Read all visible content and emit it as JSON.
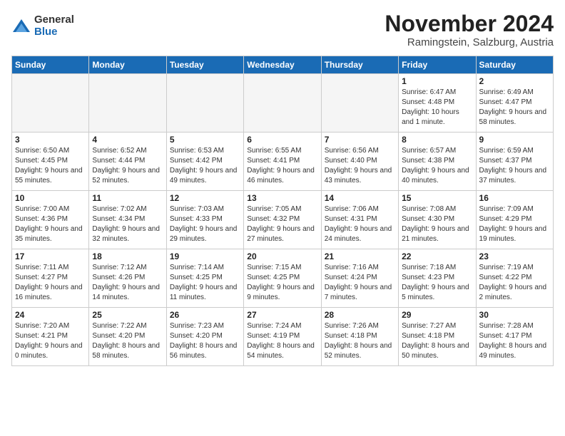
{
  "logo": {
    "general": "General",
    "blue": "Blue"
  },
  "header": {
    "month": "November 2024",
    "location": "Ramingstein, Salzburg, Austria"
  },
  "weekdays": [
    "Sunday",
    "Monday",
    "Tuesday",
    "Wednesday",
    "Thursday",
    "Friday",
    "Saturday"
  ],
  "weeks": [
    [
      {
        "day": "",
        "info": ""
      },
      {
        "day": "",
        "info": ""
      },
      {
        "day": "",
        "info": ""
      },
      {
        "day": "",
        "info": ""
      },
      {
        "day": "",
        "info": ""
      },
      {
        "day": "1",
        "info": "Sunrise: 6:47 AM\nSunset: 4:48 PM\nDaylight: 10 hours and 1 minute."
      },
      {
        "day": "2",
        "info": "Sunrise: 6:49 AM\nSunset: 4:47 PM\nDaylight: 9 hours and 58 minutes."
      }
    ],
    [
      {
        "day": "3",
        "info": "Sunrise: 6:50 AM\nSunset: 4:45 PM\nDaylight: 9 hours and 55 minutes."
      },
      {
        "day": "4",
        "info": "Sunrise: 6:52 AM\nSunset: 4:44 PM\nDaylight: 9 hours and 52 minutes."
      },
      {
        "day": "5",
        "info": "Sunrise: 6:53 AM\nSunset: 4:42 PM\nDaylight: 9 hours and 49 minutes."
      },
      {
        "day": "6",
        "info": "Sunrise: 6:55 AM\nSunset: 4:41 PM\nDaylight: 9 hours and 46 minutes."
      },
      {
        "day": "7",
        "info": "Sunrise: 6:56 AM\nSunset: 4:40 PM\nDaylight: 9 hours and 43 minutes."
      },
      {
        "day": "8",
        "info": "Sunrise: 6:57 AM\nSunset: 4:38 PM\nDaylight: 9 hours and 40 minutes."
      },
      {
        "day": "9",
        "info": "Sunrise: 6:59 AM\nSunset: 4:37 PM\nDaylight: 9 hours and 37 minutes."
      }
    ],
    [
      {
        "day": "10",
        "info": "Sunrise: 7:00 AM\nSunset: 4:36 PM\nDaylight: 9 hours and 35 minutes."
      },
      {
        "day": "11",
        "info": "Sunrise: 7:02 AM\nSunset: 4:34 PM\nDaylight: 9 hours and 32 minutes."
      },
      {
        "day": "12",
        "info": "Sunrise: 7:03 AM\nSunset: 4:33 PM\nDaylight: 9 hours and 29 minutes."
      },
      {
        "day": "13",
        "info": "Sunrise: 7:05 AM\nSunset: 4:32 PM\nDaylight: 9 hours and 27 minutes."
      },
      {
        "day": "14",
        "info": "Sunrise: 7:06 AM\nSunset: 4:31 PM\nDaylight: 9 hours and 24 minutes."
      },
      {
        "day": "15",
        "info": "Sunrise: 7:08 AM\nSunset: 4:30 PM\nDaylight: 9 hours and 21 minutes."
      },
      {
        "day": "16",
        "info": "Sunrise: 7:09 AM\nSunset: 4:29 PM\nDaylight: 9 hours and 19 minutes."
      }
    ],
    [
      {
        "day": "17",
        "info": "Sunrise: 7:11 AM\nSunset: 4:27 PM\nDaylight: 9 hours and 16 minutes."
      },
      {
        "day": "18",
        "info": "Sunrise: 7:12 AM\nSunset: 4:26 PM\nDaylight: 9 hours and 14 minutes."
      },
      {
        "day": "19",
        "info": "Sunrise: 7:14 AM\nSunset: 4:25 PM\nDaylight: 9 hours and 11 minutes."
      },
      {
        "day": "20",
        "info": "Sunrise: 7:15 AM\nSunset: 4:25 PM\nDaylight: 9 hours and 9 minutes."
      },
      {
        "day": "21",
        "info": "Sunrise: 7:16 AM\nSunset: 4:24 PM\nDaylight: 9 hours and 7 minutes."
      },
      {
        "day": "22",
        "info": "Sunrise: 7:18 AM\nSunset: 4:23 PM\nDaylight: 9 hours and 5 minutes."
      },
      {
        "day": "23",
        "info": "Sunrise: 7:19 AM\nSunset: 4:22 PM\nDaylight: 9 hours and 2 minutes."
      }
    ],
    [
      {
        "day": "24",
        "info": "Sunrise: 7:20 AM\nSunset: 4:21 PM\nDaylight: 9 hours and 0 minutes."
      },
      {
        "day": "25",
        "info": "Sunrise: 7:22 AM\nSunset: 4:20 PM\nDaylight: 8 hours and 58 minutes."
      },
      {
        "day": "26",
        "info": "Sunrise: 7:23 AM\nSunset: 4:20 PM\nDaylight: 8 hours and 56 minutes."
      },
      {
        "day": "27",
        "info": "Sunrise: 7:24 AM\nSunset: 4:19 PM\nDaylight: 8 hours and 54 minutes."
      },
      {
        "day": "28",
        "info": "Sunrise: 7:26 AM\nSunset: 4:18 PM\nDaylight: 8 hours and 52 minutes."
      },
      {
        "day": "29",
        "info": "Sunrise: 7:27 AM\nSunset: 4:18 PM\nDaylight: 8 hours and 50 minutes."
      },
      {
        "day": "30",
        "info": "Sunrise: 7:28 AM\nSunset: 4:17 PM\nDaylight: 8 hours and 49 minutes."
      }
    ]
  ]
}
